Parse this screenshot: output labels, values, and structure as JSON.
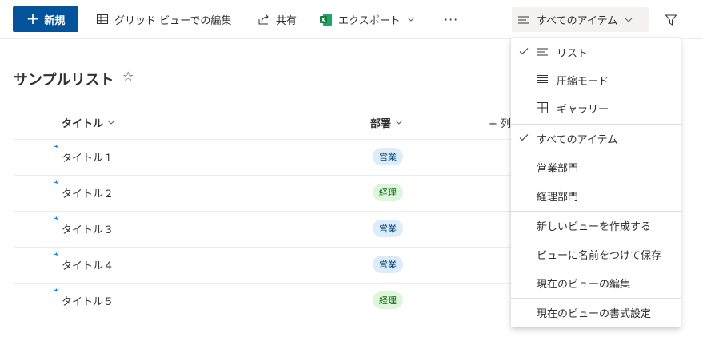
{
  "commandbar": {
    "new_label": "新規",
    "grid_edit_label": "グリッド ビューでの編集",
    "share_label": "共有",
    "export_label": "エクスポート",
    "more_label": "···",
    "current_view": "すべてのアイテム"
  },
  "list": {
    "title": "サンプルリスト",
    "favorite_icon": "☆",
    "columns": {
      "title": "タイトル",
      "dept": "部署",
      "add_column": "+ 列"
    },
    "rows": [
      {
        "title": "タイトル１",
        "dept": "営業"
      },
      {
        "title": "タイトル２",
        "dept": "経理"
      },
      {
        "title": "タイトル３",
        "dept": "営業"
      },
      {
        "title": "タイトル４",
        "dept": "営業"
      },
      {
        "title": "タイトル５",
        "dept": "経理"
      }
    ],
    "dept_colors": {
      "営業": {
        "bg": "#deecf9",
        "fg": "#004578"
      },
      "経理": {
        "bg": "#dff6dd",
        "fg": "#0b6a0b"
      }
    }
  },
  "view_menu": {
    "layouts": [
      {
        "label": "リスト",
        "icon": "list-icon",
        "checked": true
      },
      {
        "label": "圧縮モード",
        "icon": "compact-icon",
        "checked": false
      },
      {
        "label": "ギャラリー",
        "icon": "gallery-icon",
        "checked": false
      }
    ],
    "views": [
      {
        "label": "すべてのアイテム",
        "checked": true
      },
      {
        "label": "営業部門",
        "checked": false
      },
      {
        "label": "経理部門",
        "checked": false
      }
    ],
    "actions": [
      {
        "label": "新しいビューを作成する"
      },
      {
        "label": "ビューに名前をつけて保存"
      },
      {
        "label": "現在のビューの編集"
      }
    ],
    "format": {
      "label": "現在のビューの書式設定"
    }
  },
  "colors": {
    "brand": "#03539b",
    "excel": "#217346"
  }
}
